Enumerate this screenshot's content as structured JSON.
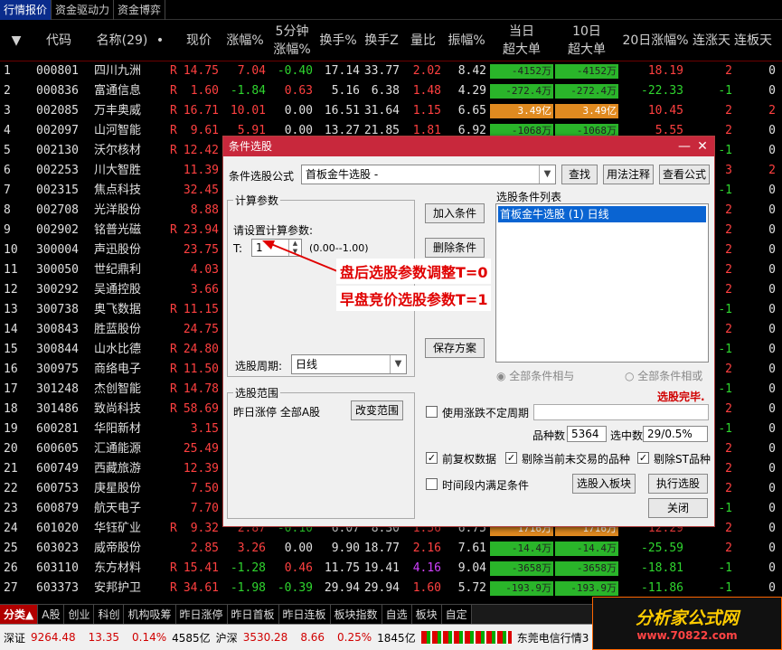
{
  "top_tabs": [
    "行情报价",
    "资金驱动力",
    "资金博弈"
  ],
  "columns": {
    "code": "代码",
    "name": "名称(29)",
    "price": "现价",
    "change_pct": "涨幅%",
    "speed5_l1": "5分钟",
    "speed5_l2": "涨幅%",
    "turnover": "换手%",
    "turnover_z": "换手Z",
    "vol_ratio": "量比",
    "amplitude": "振幅%",
    "big_l1": "当日",
    "big_l2": "超大单",
    "big10_l1": "10日",
    "big10_l2": "超大单",
    "chg20": "20日涨幅%",
    "up_days": "连涨天",
    "limit_days": "连板天"
  },
  "rows": [
    {
      "idx": "1",
      "code": "000801",
      "name": "四川九洲",
      "flag": "R",
      "price": "14.75",
      "chg": "7.04",
      "s5": "-0.40",
      "to": "17.14",
      "tz": "33.77",
      "vr": "2.02",
      "amp": "8.42",
      "big": "-4152万",
      "big10": "-4152万",
      "c20": "18.19",
      "up": "2",
      "lim": "0"
    },
    {
      "idx": "2",
      "code": "000836",
      "name": "富通信息",
      "flag": "R",
      "price": "1.60",
      "chg": "-1.84",
      "s5": "0.63",
      "to": "5.16",
      "tz": "6.38",
      "vr": "1.48",
      "amp": "4.29",
      "big": "-272.4万",
      "big10": "-272.4万",
      "c20": "-22.33",
      "up": "-1",
      "lim": "0"
    },
    {
      "idx": "3",
      "code": "002085",
      "name": "万丰奥威",
      "flag": "R",
      "price": "16.71",
      "chg": "10.01",
      "s5": "0.00",
      "to": "16.51",
      "tz": "31.64",
      "vr": "1.15",
      "amp": "6.65",
      "big": "3.49亿",
      "big10": "3.49亿",
      "c20": "10.45",
      "up": "2",
      "lim": "2"
    },
    {
      "idx": "4",
      "code": "002097",
      "name": "山河智能",
      "flag": "R",
      "price": "9.61",
      "chg": "5.91",
      "s5": "0.00",
      "to": "13.27",
      "tz": "21.85",
      "vr": "1.81",
      "amp": "6.92",
      "big": "-1068万",
      "big10": "-1068万",
      "c20": "5.55",
      "up": "2",
      "lim": "0"
    },
    {
      "idx": "5",
      "code": "002130",
      "name": "沃尔核材",
      "flag": "R",
      "price": "12.42",
      "chg": "",
      "s5": "",
      "to": "",
      "tz": "",
      "vr": "",
      "amp": "",
      "big": "",
      "big10": "",
      "c20": "",
      "up": "-1",
      "lim": "0"
    },
    {
      "idx": "6",
      "code": "002253",
      "name": "川大智胜",
      "flag": "",
      "price": "11.39",
      "chg": "",
      "s5": "",
      "to": "",
      "tz": "",
      "vr": "",
      "amp": "",
      "big": "",
      "big10": "",
      "c20": "",
      "up": "3",
      "lim": "2"
    },
    {
      "idx": "7",
      "code": "002315",
      "name": "焦点科技",
      "flag": "",
      "price": "32.45",
      "chg": "",
      "s5": "",
      "to": "",
      "tz": "",
      "vr": "",
      "amp": "",
      "big": "",
      "big10": "",
      "c20": "",
      "up": "-1",
      "lim": "0"
    },
    {
      "idx": "8",
      "code": "002708",
      "name": "光洋股份",
      "flag": "",
      "price": "8.88",
      "chg": "",
      "s5": "",
      "to": "",
      "tz": "",
      "vr": "",
      "amp": "",
      "big": "",
      "big10": "",
      "c20": "",
      "up": "2",
      "lim": "0"
    },
    {
      "idx": "9",
      "code": "002902",
      "name": "铭普光磁",
      "flag": "R",
      "price": "23.94",
      "chg": "",
      "s5": "",
      "to": "",
      "tz": "",
      "vr": "",
      "amp": "",
      "big": "",
      "big10": "",
      "c20": "",
      "up": "2",
      "lim": "0"
    },
    {
      "idx": "10",
      "code": "300004",
      "name": "声迅股份",
      "flag": "",
      "price": "23.75",
      "chg": "",
      "s5": "",
      "to": "",
      "tz": "",
      "vr": "",
      "amp": "",
      "big": "",
      "big10": "",
      "c20": "",
      "up": "2",
      "lim": "0"
    },
    {
      "idx": "11",
      "code": "300050",
      "name": "世纪鼎利",
      "flag": "",
      "price": "4.03",
      "chg": "",
      "s5": "",
      "to": "",
      "tz": "",
      "vr": "",
      "amp": "",
      "big": "",
      "big10": "",
      "c20": "",
      "up": "2",
      "lim": "0"
    },
    {
      "idx": "12",
      "code": "300292",
      "name": "吴通控股",
      "flag": "",
      "price": "3.66",
      "chg": "",
      "s5": "",
      "to": "",
      "tz": "",
      "vr": "",
      "amp": "",
      "big": "",
      "big10": "",
      "c20": "",
      "up": "2",
      "lim": "0"
    },
    {
      "idx": "13",
      "code": "300738",
      "name": "奥飞数据",
      "flag": "R",
      "price": "11.15",
      "chg": "",
      "s5": "",
      "to": "",
      "tz": "",
      "vr": "",
      "amp": "",
      "big": "",
      "big10": "",
      "c20": "",
      "up": "-1",
      "lim": "0"
    },
    {
      "idx": "14",
      "code": "300843",
      "name": "胜蓝股份",
      "flag": "",
      "price": "24.75",
      "chg": "",
      "s5": "",
      "to": "",
      "tz": "",
      "vr": "",
      "amp": "",
      "big": "",
      "big10": "",
      "c20": "",
      "up": "2",
      "lim": "0"
    },
    {
      "idx": "15",
      "code": "300844",
      "name": "山水比德",
      "flag": "R",
      "price": "24.80",
      "chg": "",
      "s5": "",
      "to": "",
      "tz": "",
      "vr": "",
      "amp": "",
      "big": "",
      "big10": "",
      "c20": "",
      "up": "-1",
      "lim": "0"
    },
    {
      "idx": "16",
      "code": "300975",
      "name": "商络电子",
      "flag": "R",
      "price": "11.50",
      "chg": "",
      "s5": "",
      "to": "",
      "tz": "",
      "vr": "",
      "amp": "",
      "big": "",
      "big10": "",
      "c20": "",
      "up": "2",
      "lim": "0"
    },
    {
      "idx": "17",
      "code": "301248",
      "name": "杰创智能",
      "flag": "R",
      "price": "14.78",
      "chg": "",
      "s5": "",
      "to": "",
      "tz": "",
      "vr": "",
      "amp": "",
      "big": "",
      "big10": "",
      "c20": "",
      "up": "-1",
      "lim": "0"
    },
    {
      "idx": "18",
      "code": "301486",
      "name": "致尚科技",
      "flag": "R",
      "price": "58.69",
      "chg": "",
      "s5": "",
      "to": "",
      "tz": "",
      "vr": "",
      "amp": "",
      "big": "",
      "big10": "",
      "c20": "",
      "up": "2",
      "lim": "0"
    },
    {
      "idx": "19",
      "code": "600281",
      "name": "华阳新材",
      "flag": "",
      "price": "3.15",
      "chg": "",
      "s5": "",
      "to": "",
      "tz": "",
      "vr": "",
      "amp": "",
      "big": "",
      "big10": "",
      "c20": "",
      "up": "-1",
      "lim": "0"
    },
    {
      "idx": "20",
      "code": "600605",
      "name": "汇通能源",
      "flag": "",
      "price": "25.49",
      "chg": "",
      "s5": "",
      "to": "",
      "tz": "",
      "vr": "",
      "amp": "",
      "big": "",
      "big10": "",
      "c20": "",
      "up": "2",
      "lim": "0"
    },
    {
      "idx": "21",
      "code": "600749",
      "name": "西藏旅游",
      "flag": "",
      "price": "12.39",
      "chg": "",
      "s5": "",
      "to": "",
      "tz": "",
      "vr": "",
      "amp": "",
      "big": "",
      "big10": "",
      "c20": "",
      "up": "2",
      "lim": "0"
    },
    {
      "idx": "22",
      "code": "600753",
      "name": "庚星股份",
      "flag": "",
      "price": "7.50",
      "chg": "",
      "s5": "",
      "to": "",
      "tz": "",
      "vr": "",
      "amp": "",
      "big": "",
      "big10": "",
      "c20": "",
      "up": "2",
      "lim": "0"
    },
    {
      "idx": "23",
      "code": "600879",
      "name": "航天电子",
      "flag": "",
      "price": "7.70",
      "chg": "",
      "s5": "",
      "to": "",
      "tz": "",
      "vr": "",
      "amp": "",
      "big": "",
      "big10": "",
      "c20": "",
      "up": "-1",
      "lim": "0"
    },
    {
      "idx": "24",
      "code": "601020",
      "name": "华钰矿业",
      "flag": "R",
      "price": "9.32",
      "chg": "2.87",
      "s5": "-0.10",
      "to": "6.07",
      "tz": "8.30",
      "vr": "1.56",
      "amp": "6.75",
      "big": "1716万",
      "big10": "1716万",
      "c20": "12.29",
      "up": "2",
      "lim": "0"
    },
    {
      "idx": "25",
      "code": "603023",
      "name": "威帝股份",
      "flag": "",
      "price": "2.85",
      "chg": "3.26",
      "s5": "0.00",
      "to": "9.90",
      "tz": "18.77",
      "vr": "2.16",
      "amp": "7.61",
      "big": "-14.4万",
      "big10": "-14.4万",
      "c20": "-25.59",
      "up": "2",
      "lim": "0"
    },
    {
      "idx": "26",
      "code": "603110",
      "name": "东方材料",
      "flag": "R",
      "price": "15.41",
      "chg": "-1.28",
      "s5": "0.46",
      "to": "11.75",
      "tz": "19.41",
      "vr": "4.16",
      "amp": "9.04",
      "big": "-3658万",
      "big10": "-3658万",
      "c20": "-18.81",
      "up": "-1",
      "lim": "0"
    },
    {
      "idx": "27",
      "code": "603373",
      "name": "安邦护卫",
      "flag": "R",
      "price": "34.61",
      "chg": "-1.98",
      "s5": "-0.39",
      "to": "29.94",
      "tz": "29.94",
      "vr": "1.60",
      "amp": "5.72",
      "big": "-193.9万",
      "big10": "-193.9万",
      "c20": "-11.86",
      "up": "-1",
      "lim": "0"
    }
  ],
  "bottom_tabs": [
    "分类▲",
    "A股",
    "创业",
    "科创",
    "机构吸筹",
    "昨日涨停",
    "昨日首板",
    "昨日连板",
    "板块指数",
    "自选",
    "板块",
    "自定"
  ],
  "status": {
    "sz_label": "深证",
    "sz_val": "9264.48",
    "sz_chg": "13.35",
    "sz_pct": "0.14%",
    "sz_amt": "4585亿",
    "hs_label": "沪深",
    "hs_val": "3530.28",
    "hs_chg": "8.66",
    "hs_pct": "0.25%",
    "hs_amt": "1845亿",
    "broker": "东莞电信行情3"
  },
  "logo": {
    "line1": "分析家公式网",
    "line2": "www.70822.com"
  },
  "dialog": {
    "title": "条件选股",
    "formula_label": "条件选股公式",
    "formula_value": "首板金牛选股 -",
    "find_btn": "查找",
    "usage_btn": "用法注释",
    "view_btn": "查看公式",
    "calc_group": "计算参数",
    "param_prompt": "请设置计算参数:",
    "param_name": "T:",
    "param_value": "1",
    "param_range": "(0.00--1.00)",
    "add_btn": "加入条件",
    "del_btn": "删除条件",
    "save_btn": "保存方案",
    "list_label": "选股条件列表",
    "list_item": "首板金牛选股 (1) 日线",
    "period_label": "选股周期:",
    "period_value": "日线",
    "opt_and": "全部条件相与",
    "opt_or": "全部条件相或",
    "done_text": "选股完毕.",
    "range_group": "选股范围",
    "range_text": "昨日涨停 全部A股",
    "change_range_btn": "改变范围",
    "use_period": "使用涨跌不定周期",
    "count_label": "品种数",
    "count_value": "5364",
    "selected_label": "选中数",
    "selected_value": "29/0.5%",
    "adj_label": "前复权数据",
    "exclude_halt": "剔除当前未交易的品种",
    "exclude_st": "剔除ST品种",
    "time_cond": "时间段内满足条件",
    "to_block_btn": "选股入板块",
    "exec_btn": "执行选股",
    "close_btn": "关闭"
  },
  "annotations": {
    "line1": "盘后选股参数调整T=0",
    "line2": "早盘竞价选股参数T=1"
  }
}
